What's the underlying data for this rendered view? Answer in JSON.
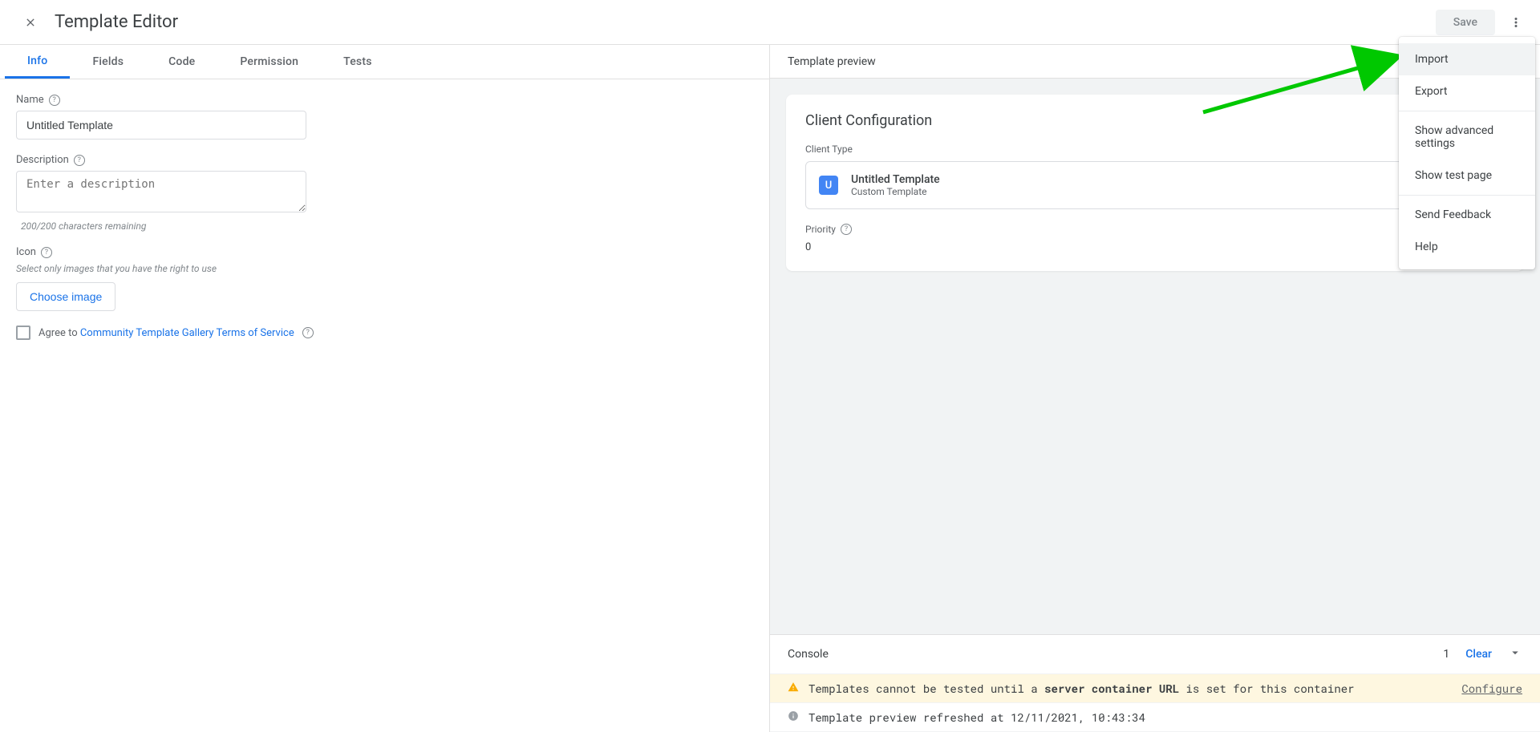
{
  "header": {
    "title": "Template Editor",
    "save_label": "Save"
  },
  "tabs": {
    "info": "Info",
    "fields": "Fields",
    "code": "Code",
    "permission": "Permission",
    "tests": "Tests"
  },
  "form": {
    "name_label": "Name",
    "name_value": "Untitled Template",
    "desc_label": "Description",
    "desc_placeholder": "Enter a description",
    "desc_hint": "200/200 characters remaining",
    "icon_label": "Icon",
    "icon_hint": "Select only images that you have the right to use",
    "choose_label": "Choose image",
    "agree_prefix": "Agree to ",
    "agree_link": "Community Template Gallery Terms of Service"
  },
  "preview": {
    "header": "Template preview",
    "card_title": "Client Configuration",
    "client_type_label": "Client Type",
    "ct_badge_letter": "U",
    "ct_title": "Untitled Template",
    "ct_sub": "Custom Template",
    "priority_label": "Priority",
    "priority_value": "0"
  },
  "console": {
    "title": "Console",
    "count": "1",
    "clear": "Clear",
    "warn_pre": "Templates cannot be tested until a ",
    "warn_bold": "server container URL",
    "warn_post": " is set for this container",
    "configure": "Configure",
    "info_msg": "Template preview refreshed at 12/11/2021, 10:43:34"
  },
  "menu": {
    "import": "Import",
    "export": "Export",
    "advanced": "Show advanced settings",
    "testpage": "Show test page",
    "feedback": "Send Feedback",
    "help": "Help"
  }
}
